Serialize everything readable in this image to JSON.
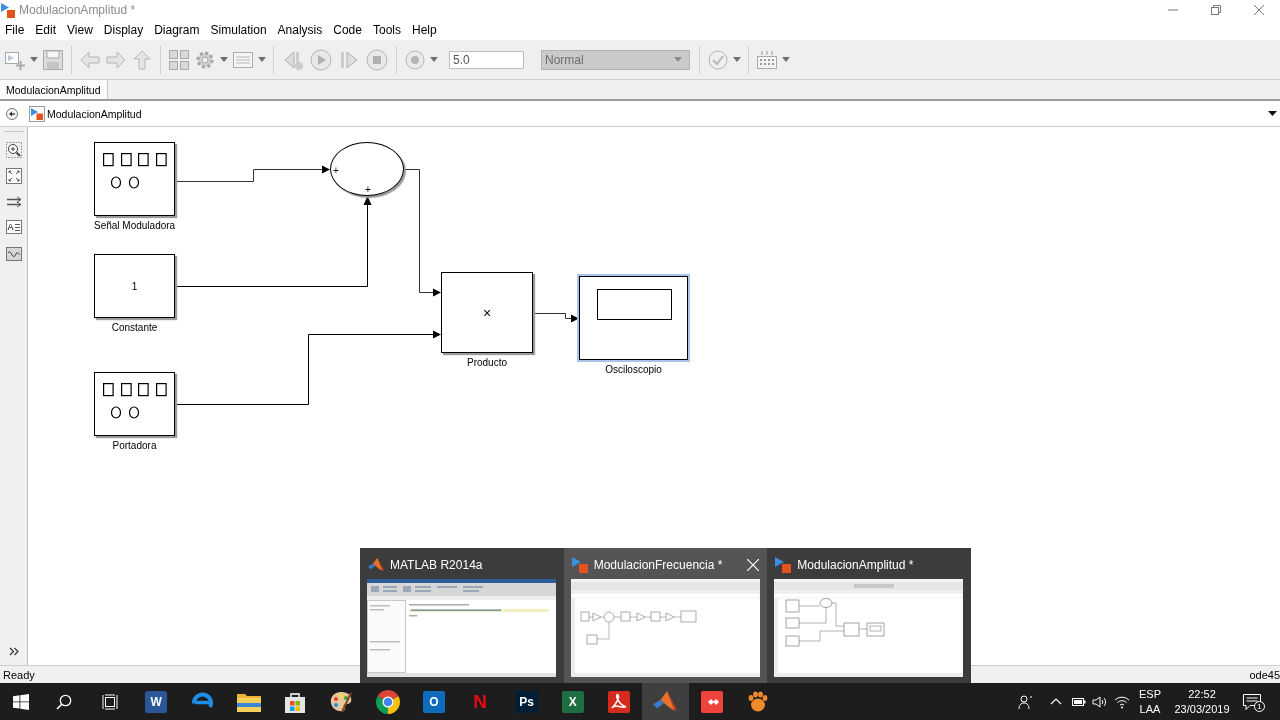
{
  "window": {
    "title": "ModulacionAmplitud *"
  },
  "menu": [
    "File",
    "Edit",
    "View",
    "Display",
    "Diagram",
    "Simulation",
    "Analysis",
    "Code",
    "Tools",
    "Help"
  ],
  "toolbar": {
    "stop_time": "5.0",
    "simulation_mode": "Normal"
  },
  "tabs": [
    {
      "label": "ModulacionAmplitud",
      "selected": true
    }
  ],
  "breadcrumb": {
    "label": "ModulacionAmplitud"
  },
  "palette": {
    "annotation_glyph": "A"
  },
  "diagram": {
    "blocks": [
      {
        "kind": "generator",
        "label": "Señal Moduladora",
        "selected": false
      },
      {
        "kind": "sum",
        "signs": [
          "+",
          "+"
        ],
        "selected": false
      },
      {
        "kind": "constant",
        "value": "1",
        "label": "Constante",
        "selected": false
      },
      {
        "kind": "product",
        "symbol": "×",
        "label": "Producto",
        "selected": false
      },
      {
        "kind": "scope",
        "label": "Osciloscopio",
        "selected": true
      },
      {
        "kind": "generator",
        "label": "Portadora",
        "selected": false
      }
    ]
  },
  "status_bar": {
    "status": "Ready",
    "solver": "ode45"
  },
  "task_switcher": [
    {
      "kind": "desktop",
      "title": "MATLAB R2014a",
      "selected": false
    },
    {
      "kind": "chain",
      "title": "ModulacionFrecuencia *",
      "selected": true
    },
    {
      "kind": "branch",
      "title": "ModulacionAmplitud *",
      "selected": false
    }
  ],
  "taskbar": {
    "apps": [
      {
        "kind": "letter-tile",
        "glyph": "W",
        "color": "#2b579a",
        "selected": false
      },
      {
        "kind": "swirl",
        "selected": false
      },
      {
        "kind": "folder",
        "selected": false
      },
      {
        "kind": "bag",
        "selected": false
      },
      {
        "kind": "palette",
        "selected": false
      },
      {
        "kind": "circle",
        "selected": false
      },
      {
        "kind": "letter-tile",
        "glyph": "O",
        "color": "#0f6cbd",
        "selected": false
      },
      {
        "kind": "letter",
        "glyph": "N",
        "color": "#e50914",
        "selected": false
      },
      {
        "kind": "letter-tile",
        "glyph": "Ps",
        "color": "#001e36",
        "selected": false
      },
      {
        "kind": "letter-tile",
        "glyph": "X",
        "color": "#1d6f42",
        "selected": false
      },
      {
        "kind": "swirl-tile",
        "selected": false
      },
      {
        "kind": "peak",
        "selected": true
      },
      {
        "kind": "diamond-tile",
        "selected": false
      },
      {
        "kind": "paw",
        "selected": false
      }
    ],
    "language": "ESP",
    "layout": "LAA",
    "time": "22:52",
    "date": "23/03/2019",
    "notifications": "1"
  }
}
